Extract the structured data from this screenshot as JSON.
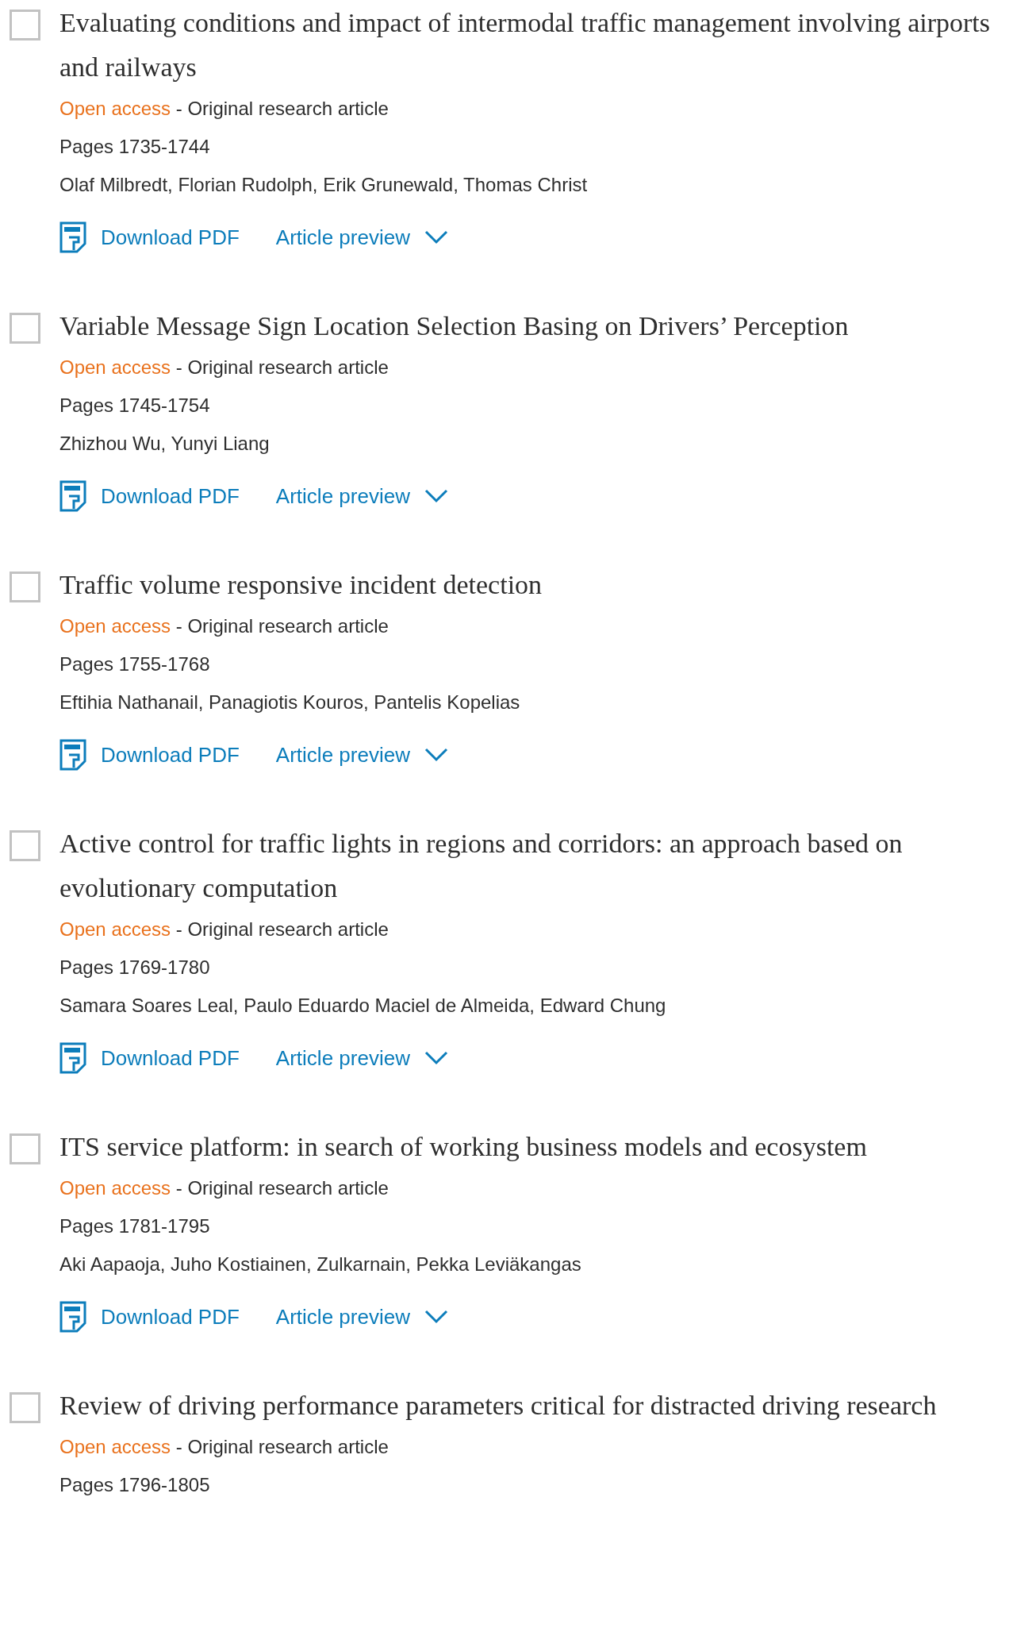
{
  "articles": [
    {
      "selected": false,
      "title": "Evaluating conditions and impact of intermodal traffic management involving airports and railways",
      "access": "Open access",
      "separator": "-",
      "type": "Original research article",
      "pages": "Pages 1735-1744",
      "authors": "Olaf Milbredt, Florian Rudolph, Erik Grunewald, Thomas Christ",
      "download": "Download PDF",
      "preview": "Article preview",
      "expanded": false
    },
    {
      "selected": false,
      "title": "Variable Message Sign Location Selection Basing on Drivers’ Perception",
      "access": "Open access",
      "separator": "-",
      "type": "Original research article",
      "pages": "Pages 1745-1754",
      "authors": "Zhizhou Wu, Yunyi Liang",
      "download": "Download PDF",
      "preview": "Article preview",
      "expanded": false
    },
    {
      "selected": false,
      "title": "Traffic volume responsive incident detection",
      "access": "Open access",
      "separator": "-",
      "type": "Original research article",
      "pages": "Pages 1755-1768",
      "authors": "Eftihia Nathanail, Panagiotis Kouros, Pantelis Kopelias",
      "download": "Download PDF",
      "preview": "Article preview",
      "expanded": false
    },
    {
      "selected": false,
      "title": "Active control for traffic lights in regions and corridors: an approach based on evolutionary computation",
      "access": "Open access",
      "separator": "-",
      "type": "Original research article",
      "pages": "Pages 1769-1780",
      "authors": "Samara Soares Leal, Paulo Eduardo Maciel de Almeida, Edward Chung",
      "download": "Download PDF",
      "preview": "Article preview",
      "expanded": false
    },
    {
      "selected": false,
      "title": "ITS service platform: in search of working business models and ecosystem",
      "access": "Open access",
      "separator": "-",
      "type": "Original research article",
      "pages": "Pages 1781-1795",
      "authors": "Aki Aapaoja, Juho Kostiainen, Zulkarnain, Pekka Leviäkangas",
      "download": "Download PDF",
      "preview": "Article preview",
      "expanded": false
    },
    {
      "selected": false,
      "title": "Review of driving performance parameters critical for distracted driving research",
      "access": "Open access",
      "separator": "-",
      "type": "Original research article",
      "pages": "Pages 1796-1805"
    }
  ]
}
